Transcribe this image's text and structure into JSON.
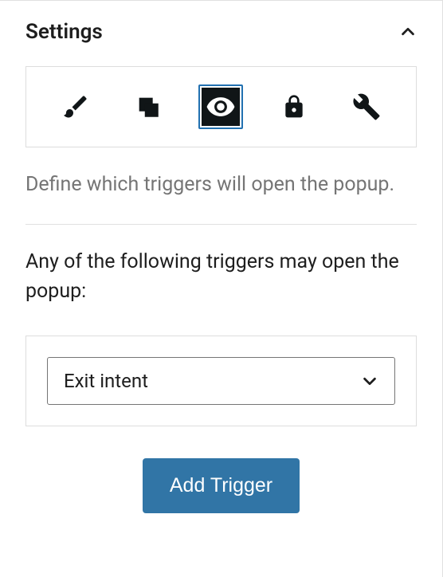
{
  "panel": {
    "title": "Settings"
  },
  "tabs": {
    "design": {
      "icon": "brush"
    },
    "display": {
      "icon": "layers"
    },
    "triggers": {
      "icon": "eye",
      "active": true
    },
    "rules": {
      "icon": "lock"
    },
    "advanced": {
      "icon": "wrench"
    }
  },
  "description": "Define which triggers will open the popup.",
  "section_label": "Any of the following triggers may open the popup:",
  "trigger_select": {
    "value": "Exit intent"
  },
  "add_button": {
    "label": "Add Trigger"
  }
}
